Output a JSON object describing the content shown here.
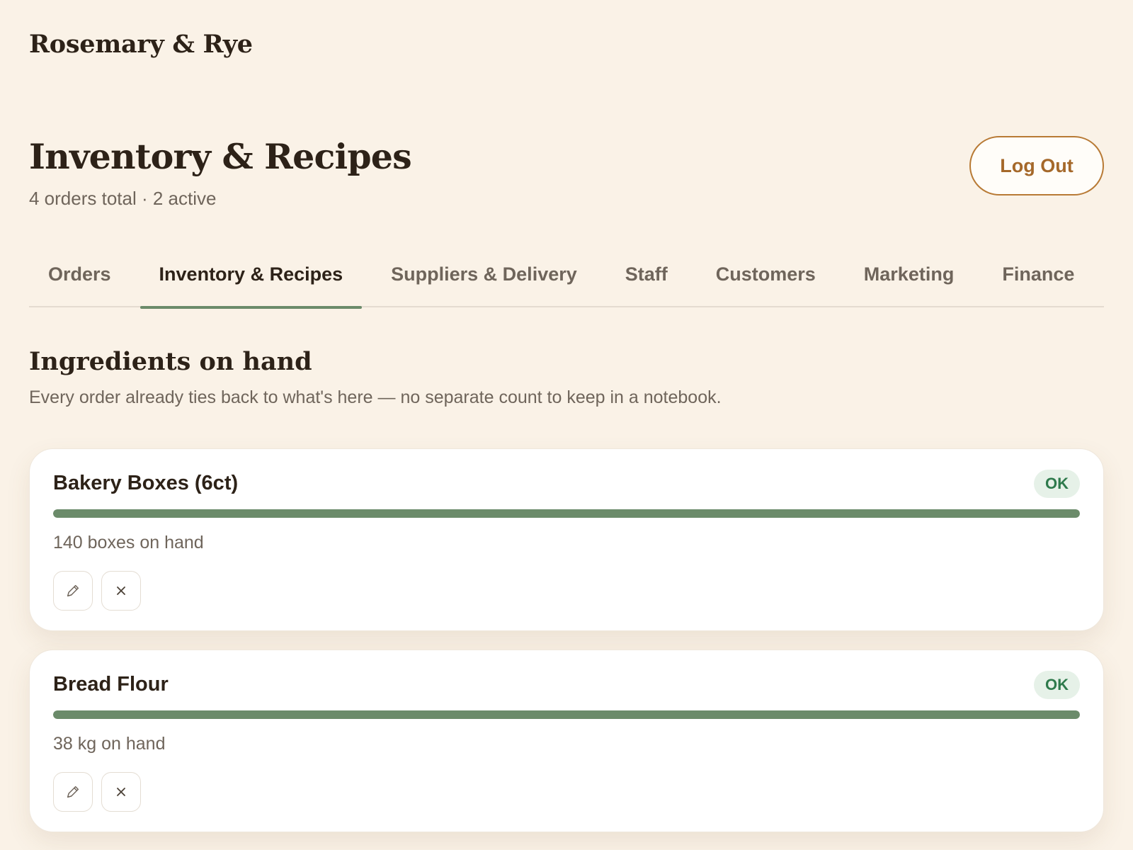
{
  "brand": "Rosemary & Rye",
  "header": {
    "title": "Inventory & Recipes",
    "subtitle": "4 orders total · 2 active",
    "logout_label": "Log Out"
  },
  "tabs": [
    {
      "label": "Orders",
      "active": false
    },
    {
      "label": "Inventory & Recipes",
      "active": true
    },
    {
      "label": "Suppliers & Delivery",
      "active": false
    },
    {
      "label": "Staff",
      "active": false
    },
    {
      "label": "Customers",
      "active": false
    },
    {
      "label": "Marketing",
      "active": false
    },
    {
      "label": "Finance",
      "active": false
    }
  ],
  "section": {
    "title": "Ingredients on hand",
    "description": "Every order already ties back to what's here — no separate count to keep in a notebook."
  },
  "items": [
    {
      "name": "Bakery Boxes (6ct)",
      "status": "OK",
      "stock_text": "140 boxes on hand",
      "level": 1.0,
      "edit_icon": "pencil-icon",
      "remove_icon": "close-icon"
    },
    {
      "name": "Bread Flour",
      "status": "OK",
      "stock_text": "38 kg on hand",
      "level": 1.0,
      "edit_icon": "pencil-icon",
      "remove_icon": "close-icon"
    }
  ],
  "colors": {
    "background": "#faf2e7",
    "accent": "#6b8b6a",
    "logout": "#a5682a",
    "badge_ok_bg": "#e6f1e8",
    "badge_ok_text": "#2e7a4c"
  }
}
